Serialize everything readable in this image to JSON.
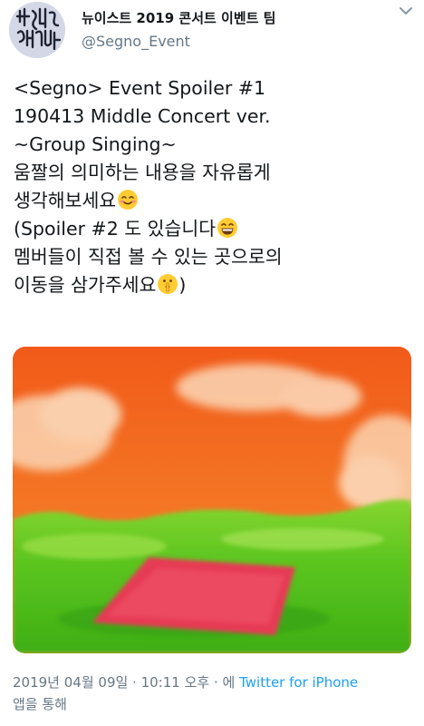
{
  "tweet": {
    "display_name": "뉴이스트 2019 콘서트 이벤트 팀",
    "handle": "@Segno_Event",
    "text_lines": [
      "<Segno> Event Spoiler #1",
      "190413 Middle Concert ver.",
      "~Group Singing~",
      "움짤의 의미하는 내용을 자유롭게",
      "생각해보세요",
      "(Spoiler #2 도 있습니다",
      "멤버들이 직접 볼 수 있는 곳으로의",
      "이동을 삼가주세요",
      ")"
    ],
    "emojis": {
      "line5": "smiling-face-icon",
      "line6": "grinning-face-icon",
      "line8": "shushing-face-icon"
    },
    "media": {
      "description_icon": "painting-image",
      "colors": {
        "sky": "#f26a1f",
        "grass": "#55c21e",
        "blanket": "#e63a52"
      }
    },
    "timestamp": "2019년 04월 09일 · 10:11 오후 · 에",
    "source": "Twitter for iPhone",
    "via_suffix": "앱을 통해"
  },
  "colors": {
    "link": "#1da1f2",
    "muted": "#657786",
    "text": "#14171a"
  }
}
